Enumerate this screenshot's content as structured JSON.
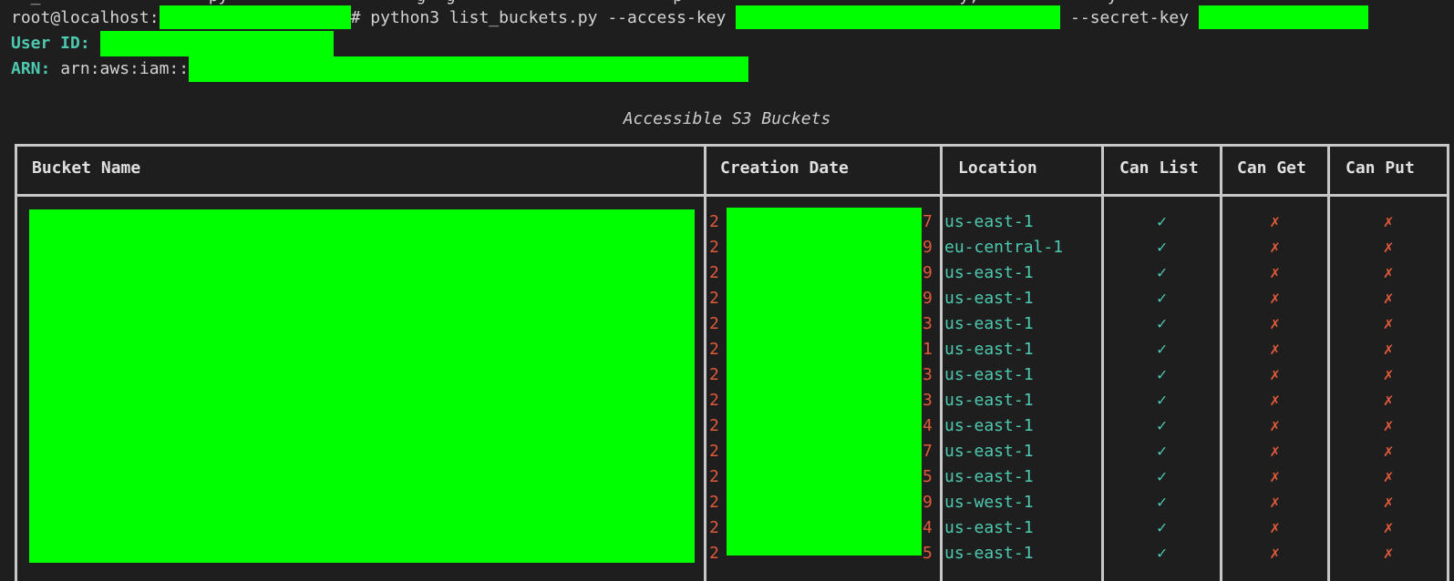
{
  "terminal": {
    "partial_top_line": "  _                 py                   g  g                      p                            y,             y",
    "prompt_user": "root@localhost:",
    "prompt_hash": "# python3 list_buckets.py --access-key ",
    "secret_flag": " --secret-key ",
    "user_id_label": "User ID:",
    "arn_label": "ARN:",
    "arn_prefix": " arn:aws:iam::"
  },
  "table": {
    "title": "Accessible S3 Buckets",
    "columns": [
      "Bucket Name",
      "Creation Date",
      "Location",
      "Can List",
      "Can Get",
      "Can Put"
    ],
    "rows": [
      {
        "date_start": "2",
        "date_end": "7",
        "location": "us-east-1",
        "can_list": "✓",
        "can_get": "✗",
        "can_put": "✗"
      },
      {
        "date_start": "2",
        "date_end": "9",
        "location": "eu-central-1",
        "can_list": "✓",
        "can_get": "✗",
        "can_put": "✗"
      },
      {
        "date_start": "2",
        "date_end": "9",
        "location": "us-east-1",
        "can_list": "✓",
        "can_get": "✗",
        "can_put": "✗"
      },
      {
        "date_start": "2",
        "date_end": "9",
        "location": "us-east-1",
        "can_list": "✓",
        "can_get": "✗",
        "can_put": "✗"
      },
      {
        "date_start": "2",
        "date_end": "3",
        "location": "us-east-1",
        "can_list": "✓",
        "can_get": "✗",
        "can_put": "✗"
      },
      {
        "date_start": "2",
        "date_end": "1",
        "location": "us-east-1",
        "can_list": "✓",
        "can_get": "✗",
        "can_put": "✗"
      },
      {
        "date_start": "2",
        "date_end": "3",
        "location": "us-east-1",
        "can_list": "✓",
        "can_get": "✗",
        "can_put": "✗"
      },
      {
        "date_start": "2",
        "date_end": "3",
        "location": "us-east-1",
        "can_list": "✓",
        "can_get": "✗",
        "can_put": "✗"
      },
      {
        "date_start": "2",
        "date_end": "4",
        "location": "us-east-1",
        "can_list": "✓",
        "can_get": "✗",
        "can_put": "✗"
      },
      {
        "date_start": "2",
        "date_end": "7",
        "location": "us-east-1",
        "can_list": "✓",
        "can_get": "✗",
        "can_put": "✗"
      },
      {
        "date_start": "2",
        "date_end": "5",
        "location": "us-east-1",
        "can_list": "✓",
        "can_get": "✗",
        "can_put": "✗"
      },
      {
        "date_start": "2",
        "date_end": "9",
        "location": "us-west-1",
        "can_list": "✓",
        "can_get": "✗",
        "can_put": "✗"
      },
      {
        "date_start": "2",
        "date_end": "4",
        "location": "us-east-1",
        "can_list": "✓",
        "can_get": "✗",
        "can_put": "✗"
      },
      {
        "date_start": "2",
        "date_end": "5",
        "location": "us-east-1",
        "can_list": "✓",
        "can_get": "✗",
        "can_put": "✗"
      }
    ]
  },
  "colors": {
    "background": "#1e1e1e",
    "redaction": "#00ff00",
    "accent_green": "#4ec9b0",
    "cross_red": "#e05a3c"
  }
}
